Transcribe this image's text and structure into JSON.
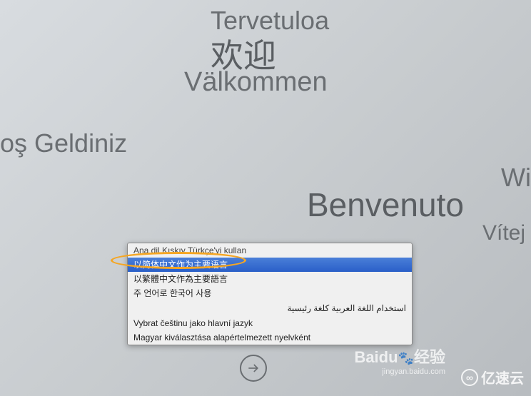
{
  "welcome_texts": {
    "finnish": "Tervetuloa",
    "chinese_simplified": "欢迎",
    "swedish": "Välkommen",
    "turkish_partial": "oş Geldiniz",
    "partial_right": "Wi",
    "italian": "Benvenuto",
    "czech_partial": "Vítej"
  },
  "language_dropdown": {
    "items": [
      {
        "label": "Ana dil Kıskıv Türkçe'yi kullan",
        "truncated": true
      },
      {
        "label": "以简体中文作为主要语言",
        "selected": true
      },
      {
        "label": "以繁體中文作為主要語言"
      },
      {
        "label": "주 언어로 한국어 사용"
      },
      {
        "label": "استخدام اللغة العربية كلغة رئيسية",
        "rtl": true
      },
      {
        "label": "Vybrat češtinu jako hlavní jazyk"
      },
      {
        "label": "Magyar kiválasztása alapértelmezett nyelvként"
      }
    ]
  },
  "watermarks": {
    "baidu": "Baidu",
    "baidu_suffix": "经验",
    "baidu_url": "jingyan.baidu.com",
    "yisu": "亿速云"
  }
}
